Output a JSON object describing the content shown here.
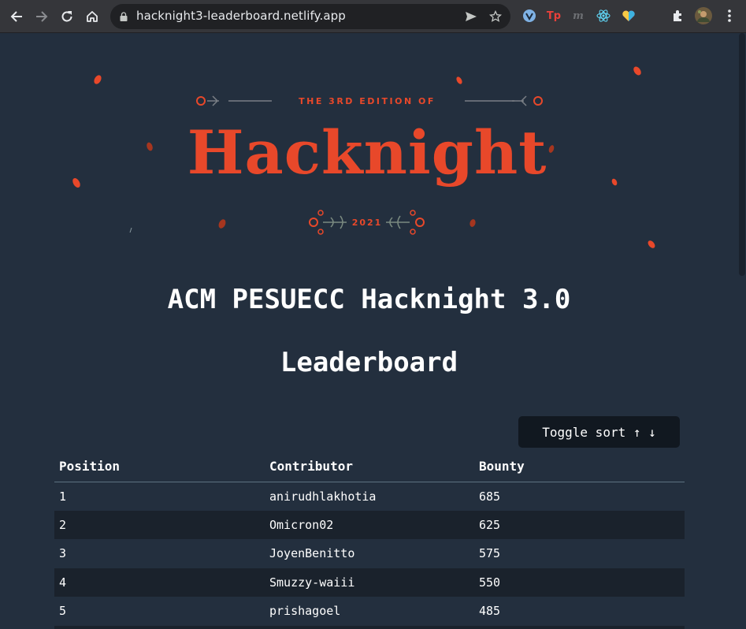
{
  "browser": {
    "url": "hacknight3-leaderboard.netlify.app"
  },
  "banner": {
    "edition_text": "THE 3RD EDITION OF",
    "logo_text": "Hacknight",
    "year": "2021",
    "accent_color": "#e8482a"
  },
  "page": {
    "title": "ACM PESUECC Hacknight 3.0",
    "subtitle": "Leaderboard",
    "toggle_label": "Toggle sort ↑ ↓"
  },
  "table": {
    "headers": [
      "Position",
      "Contributor",
      "Bounty"
    ],
    "rows": [
      [
        "1",
        "anirudhlakhotia",
        "685"
      ],
      [
        "2",
        "Omicron02",
        "625"
      ],
      [
        "3",
        "JoyenBenitto",
        "575"
      ],
      [
        "4",
        "Smuzzy-waiii",
        "550"
      ],
      [
        "5",
        "prishagoel",
        "485"
      ]
    ]
  }
}
